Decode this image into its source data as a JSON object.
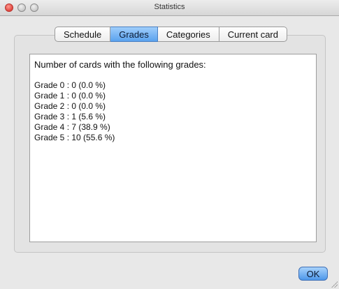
{
  "window": {
    "title": "Statistics"
  },
  "tabs": [
    {
      "label": "Schedule"
    },
    {
      "label": "Grades",
      "active": true
    },
    {
      "label": "Categories"
    },
    {
      "label": "Current card"
    }
  ],
  "content": {
    "header": "Number of cards with the following grades:",
    "lines": [
      "Grade 0 : 0 (0.0 %)",
      "Grade 1 : 0 (0.0 %)",
      "Grade 2 : 0 (0.0 %)",
      "Grade 3 : 1 (5.6 %)",
      "Grade 4 : 7 (38.9 %)",
      "Grade 5 : 10 (55.6 %)"
    ]
  },
  "buttons": {
    "ok_label": "OK"
  },
  "colors": {
    "accent": "#5aa2ee",
    "close": "#e0443e"
  }
}
